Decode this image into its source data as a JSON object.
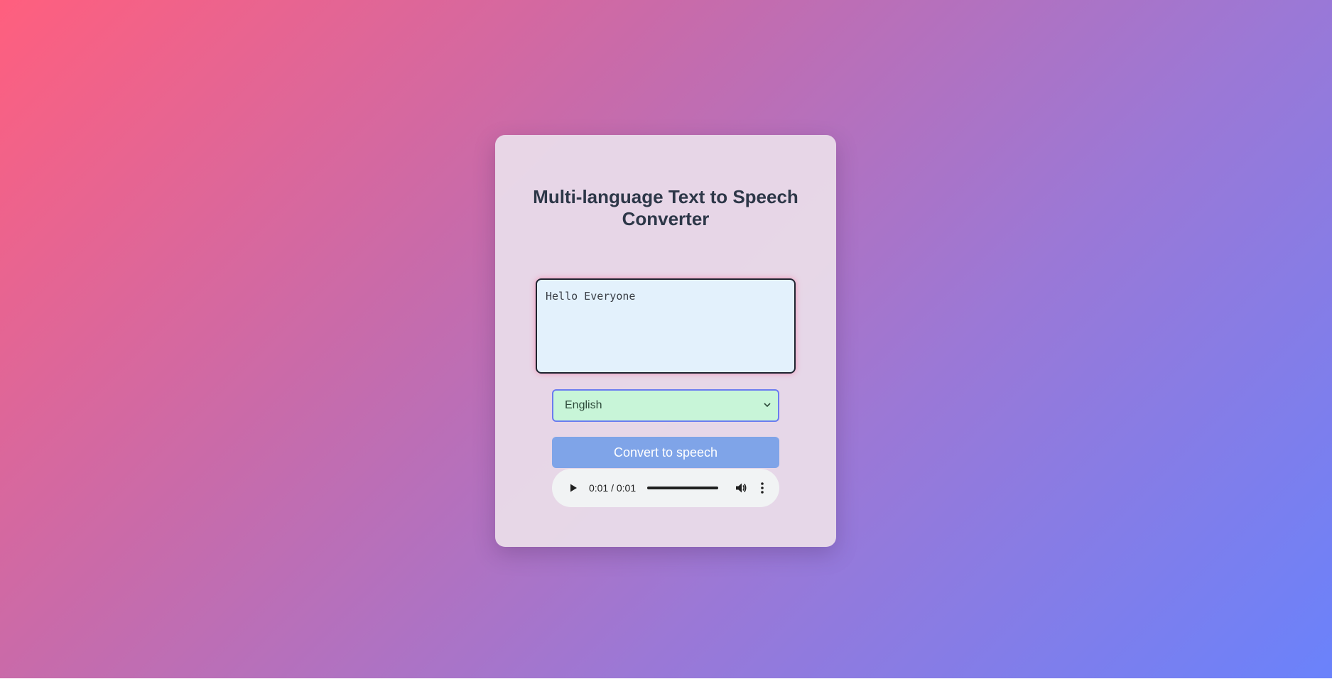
{
  "title": "Multi-language Text to Speech Converter",
  "text_input": {
    "value": "Hello Everyone"
  },
  "language_select": {
    "selected": "English",
    "icon": "chevron-down-icon"
  },
  "convert_button": {
    "label": "Convert to speech"
  },
  "audio_player": {
    "time": "0:01 / 0:01",
    "progress": 1.0,
    "icons": [
      "play-icon",
      "volume-icon",
      "more-vert-icon"
    ]
  },
  "colors": {
    "gradient_start": "#ff5f7e",
    "gradient_end": "#6a82fb",
    "card_bg": "#e8dae8",
    "title_text": "#2d3748",
    "textarea_bg": "#e3f1fc",
    "select_bg": "#c8f5d8",
    "select_border": "#6b7cf0",
    "button_bg": "#7fa4e8",
    "player_bg": "#f1f3f4"
  }
}
